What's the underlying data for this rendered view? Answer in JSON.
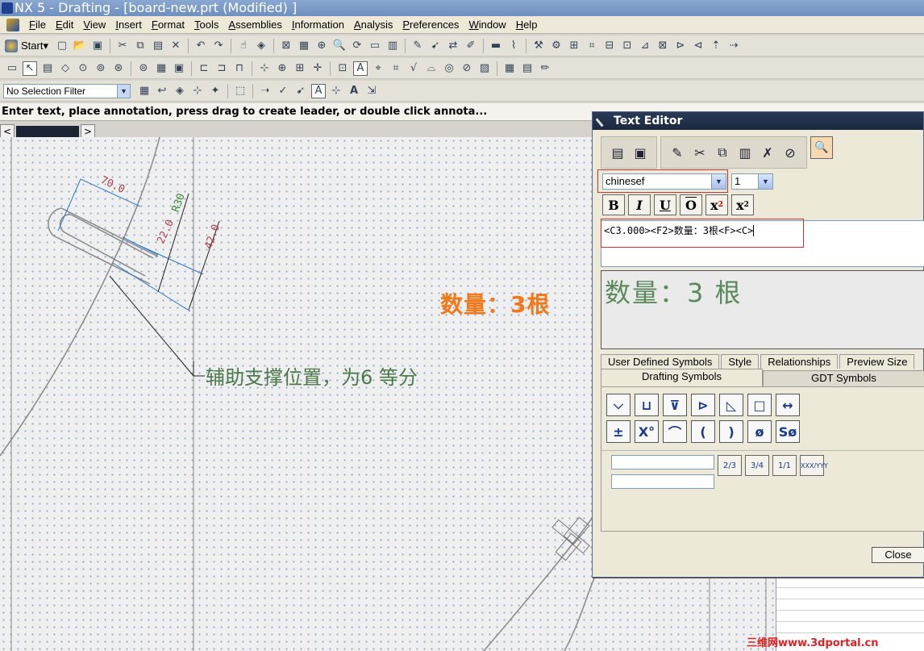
{
  "window": {
    "title": "NX 5 - Drafting - [board-new.prt (Modified) ]"
  },
  "menu": [
    "File",
    "Edit",
    "View",
    "Insert",
    "Format",
    "Tools",
    "Assemblies",
    "Information",
    "Analysis",
    "Preferences",
    "Window",
    "Help"
  ],
  "toolbar": {
    "start_label": "Start",
    "selection_filter": "No Selection Filter"
  },
  "cue_line": "Enter text, place annotation, press drag to create leader, or double click annota...",
  "drawing": {
    "note_orange": "数量：3根",
    "note_green": "辅助支撑位置，为6 等分",
    "dim_70": "70.0",
    "dim_22": "22.0",
    "dim_r30": "R30",
    "dim_42": "42.0",
    "colors": {
      "orange": "#f07818",
      "green": "#4a7a4a",
      "dim": "#b04050"
    }
  },
  "text_editor": {
    "title": "Text Editor",
    "font": "chinesef",
    "size": "1",
    "format_buttons": [
      "B",
      "I",
      "U",
      "O",
      "x2",
      "x2"
    ],
    "edit_text": "<C3.000><F2>数量：3根<F><C>",
    "preview_text": "数量：3 根",
    "tabs_row1": [
      "User Defined Symbols",
      "Style",
      "Relationships",
      "Preview Size"
    ],
    "tabs_row2": [
      "Drafting Symbols",
      "GDT Symbols"
    ],
    "symbols": [
      "⌵",
      "⊔",
      "⊽",
      "⊳",
      "◺",
      "□",
      "↔",
      "±",
      "X°",
      "⌒",
      "(",
      ")",
      "ø",
      "Sø"
    ],
    "fraction_buttons": [
      "2/3",
      "3/4",
      "1/1",
      "XXX/YYY"
    ],
    "close_label": "Close"
  },
  "watermark": "三维网www.3dportal.cn"
}
